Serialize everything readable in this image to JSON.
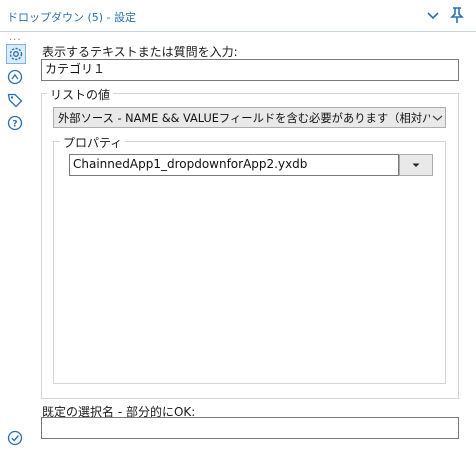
{
  "header": {
    "title": "ドロップダウン (5) - 設定"
  },
  "sidebar": {
    "more": "...",
    "icons": [
      "gear-icon",
      "connection-icon",
      "tag-icon",
      "help-icon"
    ],
    "bottom_icon": "check-circle-icon"
  },
  "question": {
    "label": "表示するテキストまたは質問を入力:",
    "value": "カテゴリ１"
  },
  "list_values": {
    "group_label": "リストの値",
    "source_selected": "外部ソース -  NAME && VALUEフィールドを含む必要があります（相対パス"
  },
  "properties": {
    "group_label": "プロパティ",
    "file_value": "ChainnedApp1_dropdownforApp2.yxdb"
  },
  "default_selection": {
    "label": "既定の選択名 - 部分的にOK:",
    "value": ""
  },
  "colors": {
    "accent": "#2b6fb3",
    "active_icon_bg": "#dcebf8"
  }
}
